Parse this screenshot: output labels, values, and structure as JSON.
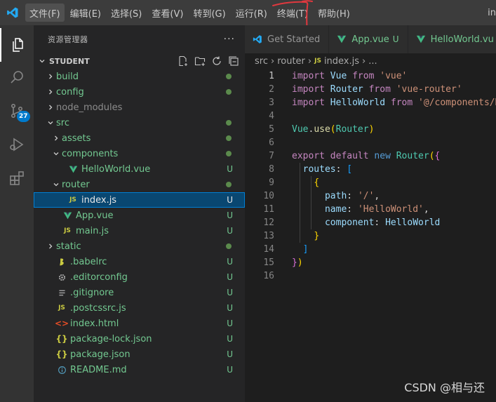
{
  "menubar": {
    "items": [
      "文件(F)",
      "编辑(E)",
      "选择(S)",
      "查看(V)",
      "转到(G)",
      "运行(R)",
      "终端(T)",
      "帮助(H)"
    ],
    "title_fragment": "in"
  },
  "activitybar": {
    "items": [
      "explorer-icon",
      "search-icon",
      "source-control-icon",
      "run-debug-icon",
      "extensions-icon"
    ],
    "scm_badge": "27"
  },
  "sidebar": {
    "title": "资源管理器",
    "more": "···",
    "section_title": "STUDENT",
    "section_actions": [
      "new-file-icon",
      "new-folder-icon",
      "refresh-icon",
      "collapse-all-icon"
    ],
    "tree": [
      {
        "name": "build",
        "status": "",
        "kind": "folder"
      },
      {
        "name": "config",
        "status": "",
        "kind": "folder"
      },
      {
        "name": "node_modules",
        "status": "",
        "kind": "folder"
      },
      {
        "name": "src",
        "status": "",
        "kind": "folder"
      },
      {
        "name": "assets",
        "status": "",
        "kind": "folder"
      },
      {
        "name": "components",
        "status": "",
        "kind": "folder"
      },
      {
        "name": "HelloWorld.vue",
        "status": "U",
        "kind": "vue"
      },
      {
        "name": "router",
        "status": "",
        "kind": "folder"
      },
      {
        "name": "index.js",
        "status": "U",
        "kind": "js"
      },
      {
        "name": "App.vue",
        "status": "U",
        "kind": "vue"
      },
      {
        "name": "main.js",
        "status": "U",
        "kind": "js"
      },
      {
        "name": "static",
        "status": "",
        "kind": "folder"
      },
      {
        "name": ".babelrc",
        "status": "U",
        "kind": "babel"
      },
      {
        "name": ".editorconfig",
        "status": "U",
        "kind": "gear"
      },
      {
        "name": ".gitignore",
        "status": "U",
        "kind": "lines"
      },
      {
        "name": ".postcssrc.js",
        "status": "U",
        "kind": "js"
      },
      {
        "name": "index.html",
        "status": "U",
        "kind": "html"
      },
      {
        "name": "package-lock.json",
        "status": "U",
        "kind": "json"
      },
      {
        "name": "package.json",
        "status": "U",
        "kind": "json"
      },
      {
        "name": "README.md",
        "status": "U",
        "kind": "info"
      }
    ]
  },
  "tabs": [
    {
      "label": "Get Started",
      "status": ""
    },
    {
      "label": "App.vue",
      "status": "U"
    },
    {
      "label": "HelloWorld.vu",
      "status": ""
    }
  ],
  "breadcrumb": {
    "parts": [
      "src",
      "router",
      "index.js",
      "..."
    ],
    "js_badge": "JS"
  },
  "code": {
    "line_numbers": [
      "1",
      "2",
      "3",
      "4",
      "5",
      "6",
      "7",
      "8",
      "9",
      "10",
      "11",
      "12",
      "13",
      "14",
      "15",
      "16"
    ],
    "lines": [
      [
        [
          "kc",
          "import"
        ],
        [
          "pun",
          " "
        ],
        [
          "id",
          "Vue"
        ],
        [
          "pun",
          " "
        ],
        [
          "kc",
          "from"
        ],
        [
          "pun",
          " "
        ],
        [
          "str",
          "'vue'"
        ]
      ],
      [
        [
          "kc",
          "import"
        ],
        [
          "pun",
          " "
        ],
        [
          "id",
          "Router"
        ],
        [
          "pun",
          " "
        ],
        [
          "kc",
          "from"
        ],
        [
          "pun",
          " "
        ],
        [
          "str",
          "'vue-router'"
        ]
      ],
      [
        [
          "kc",
          "import"
        ],
        [
          "pun",
          " "
        ],
        [
          "id",
          "HelloWorld"
        ],
        [
          "pun",
          " "
        ],
        [
          "kc",
          "from"
        ],
        [
          "pun",
          " "
        ],
        [
          "str",
          "'@/components/H"
        ]
      ],
      [],
      [
        [
          "cls",
          "Vue"
        ],
        [
          "pun",
          "."
        ],
        [
          "fn",
          "use"
        ],
        [
          "br1",
          "("
        ],
        [
          "cls",
          "Router"
        ],
        [
          "br1",
          ")"
        ]
      ],
      [],
      [
        [
          "kc",
          "export"
        ],
        [
          "pun",
          " "
        ],
        [
          "kc",
          "default"
        ],
        [
          "pun",
          " "
        ],
        [
          "kw",
          "new"
        ],
        [
          "pun",
          " "
        ],
        [
          "cls",
          "Router"
        ],
        [
          "br1",
          "("
        ],
        [
          "br2",
          "{"
        ]
      ],
      [
        [
          "pun",
          "  "
        ],
        [
          "id",
          "routes"
        ],
        [
          "pun",
          ": "
        ],
        [
          "br3",
          "["
        ]
      ],
      [
        [
          "pun",
          "    "
        ],
        [
          "br1",
          "{"
        ]
      ],
      [
        [
          "pun",
          "      "
        ],
        [
          "id",
          "path"
        ],
        [
          "pun",
          ": "
        ],
        [
          "str",
          "'/'"
        ],
        [
          "pun",
          ","
        ]
      ],
      [
        [
          "pun",
          "      "
        ],
        [
          "id",
          "name"
        ],
        [
          "pun",
          ": "
        ],
        [
          "str",
          "'HelloWorld'"
        ],
        [
          "pun",
          ","
        ]
      ],
      [
        [
          "pun",
          "      "
        ],
        [
          "id",
          "component"
        ],
        [
          "pun",
          ": "
        ],
        [
          "id",
          "HelloWorld"
        ]
      ],
      [
        [
          "pun",
          "    "
        ],
        [
          "br1",
          "}"
        ]
      ],
      [
        [
          "pun",
          "  "
        ],
        [
          "br3",
          "]"
        ]
      ],
      [
        [
          "br2",
          "}"
        ],
        [
          "br1",
          ")"
        ]
      ],
      []
    ]
  },
  "watermark": "CSDN @相与还"
}
